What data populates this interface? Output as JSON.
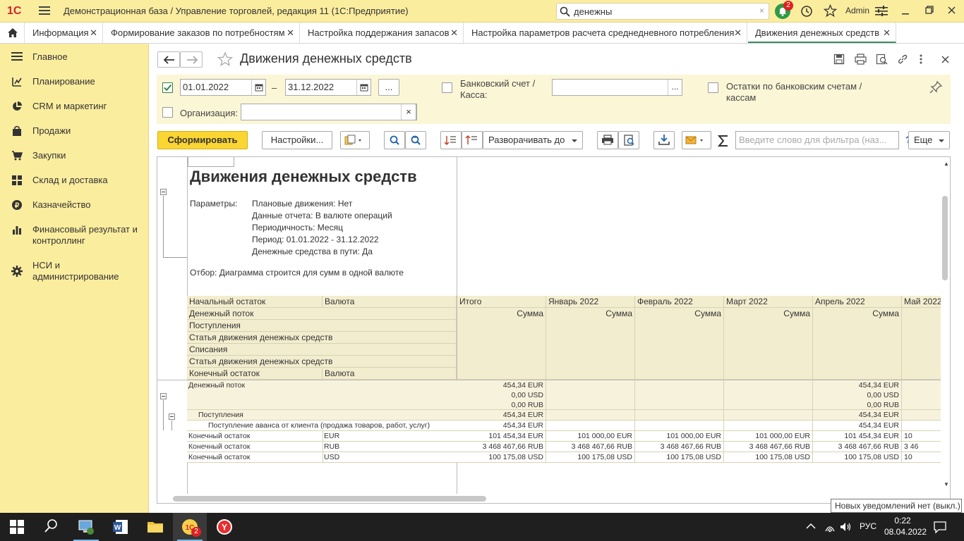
{
  "titlebar": {
    "logo": "1С",
    "title": "Демонстрационная база / Управление торговлей, редакция 11  (1С:Предприятие)",
    "search_value": "денежны",
    "notifications_count": "2",
    "user": "Admin"
  },
  "tabs": [
    {
      "label": "Информация"
    },
    {
      "label": "Формирование заказов по потребностям"
    },
    {
      "label": "Настройка поддержания запасов"
    },
    {
      "label": "Настройка параметров расчета среднедневного потребления"
    },
    {
      "label": "Движения денежных средств"
    }
  ],
  "sidebar": {
    "items": [
      {
        "label": "Главное",
        "icon": "menu-lines-icon"
      },
      {
        "label": "Планирование",
        "icon": "planning-icon"
      },
      {
        "label": "CRM и маркетинг",
        "icon": "pie-chart-icon"
      },
      {
        "label": "Продажи",
        "icon": "shopping-bag-icon"
      },
      {
        "label": "Закупки",
        "icon": "cart-icon"
      },
      {
        "label": "Склад и доставка",
        "icon": "warehouse-grid-icon"
      },
      {
        "label": "Казначейство",
        "icon": "coin-icon"
      },
      {
        "label": "Финансовый результат и контроллинг",
        "icon": "bar-chart-icon"
      },
      {
        "label": "НСИ и администрирование",
        "icon": "gear-icon"
      }
    ]
  },
  "page": {
    "title": "Движения денежных средств"
  },
  "filters": {
    "date_from": "01.01.2022",
    "dash": "–",
    "date_to": "31.12.2022",
    "more": "...",
    "bank_label_1": "Банковский счет /",
    "bank_label_2": "Касса:",
    "bank_value": "",
    "balances_label_1": "Остатки по банковским счетам /",
    "balances_label_2": "кассам",
    "org_label": "Организация:",
    "org_value": "",
    "clear": "×"
  },
  "toolbar": {
    "generate": "Сформировать",
    "settings": "Настройки...",
    "expand_to": "Разворачивать до",
    "filter_placeholder": "Введите слово для фильтра (наз...",
    "help": "?",
    "more": "Еще"
  },
  "report": {
    "title": "Движения денежных средств",
    "params_label": "Параметры:",
    "params": [
      "Плановые движения: Нет",
      "Данные отчета: В валюте операций",
      "Периодичность: Месяц",
      "Период: 01.01.2022 - 31.12.2022",
      "Денежные средства в пути: Да"
    ],
    "selection": "Отбор: Диаграмма строится для сумм в одной валюте",
    "header_rows": [
      "Начальный остаток",
      "Денежный поток",
      "Поступления",
      "Статья движения денежных средств",
      "Списания",
      "Статья движения денежных средств",
      "Конечный остаток"
    ],
    "currency_header": "Валюта",
    "columns": [
      "Итого",
      "Январь 2022",
      "Февраль 2022",
      "Март 2022",
      "Апрель 2022",
      "Май 2022"
    ],
    "sum_label": "Сумма",
    "rows": [
      {
        "label": "Денежный поток",
        "currency": "",
        "values": [
          [
            "454,34 EUR",
            "0,00 USD",
            "0,00 RUB"
          ],
          [],
          [],
          [],
          [
            "454,34 EUR",
            "0,00 USD",
            "0,00 RUB"
          ],
          []
        ]
      },
      {
        "label": "Поступления",
        "currency": "",
        "values": [
          [
            "454,34 EUR"
          ],
          [],
          [],
          [],
          [
            "454,34 EUR"
          ],
          []
        ]
      },
      {
        "label": "Поступление аванса от клиента (продажа товаров, работ, услуг)",
        "currency": "",
        "values": [
          [
            "454,34 EUR"
          ],
          [],
          [],
          [],
          [
            "454,34 EUR"
          ],
          []
        ]
      },
      {
        "label": "Конечный остаток",
        "currency": "EUR",
        "values": [
          [
            "101 454,34 EUR"
          ],
          [
            "101 000,00 EUR"
          ],
          [
            "101 000,00 EUR"
          ],
          [
            "101 000,00 EUR"
          ],
          [
            "101 454,34 EUR"
          ],
          [
            "10"
          ]
        ]
      },
      {
        "label": "Конечный остаток",
        "currency": "RUB",
        "values": [
          [
            "3 468 467,66 RUB"
          ],
          [
            "3 468 467,66 RUB"
          ],
          [
            "3 468 467,66 RUB"
          ],
          [
            "3 468 467,66 RUB"
          ],
          [
            "3 468 467,66 RUB"
          ],
          [
            "3 46"
          ]
        ]
      },
      {
        "label": "Конечный остаток",
        "currency": "USD",
        "values": [
          [
            "100 175,08 USD"
          ],
          [
            "100 175,08 USD"
          ],
          [
            "100 175,08 USD"
          ],
          [
            "100 175,08 USD"
          ],
          [
            "100 175,08 USD"
          ],
          [
            "10"
          ]
        ]
      }
    ]
  },
  "tooltip": "Новых уведомлений нет (выкл.)",
  "taskbar": {
    "lang": "РУС",
    "time": "0:22",
    "date": "08.04.2022",
    "badge": "2"
  }
}
